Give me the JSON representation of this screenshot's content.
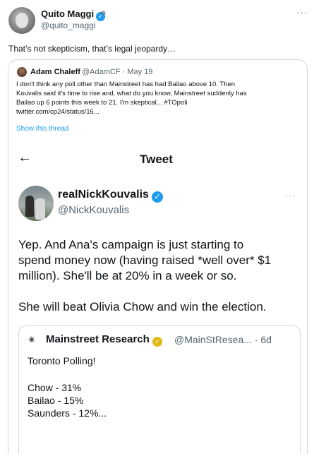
{
  "tweet": {
    "author_name": "Quito Maggi",
    "author_handle": "@quito_maggi",
    "text": "That’s not skepticism, that’s legal jeopardy…"
  },
  "quoted": {
    "author_name": "Adam Chaleff",
    "meta": "@AdamCF · May 19",
    "body_lines": [
      "I don't think any poll other than Mainstreet has had Bailao above 10. Then",
      "Kouvalis said it's time to rise and, what do you know, Mainstreet suddenly has",
      "Bailao up 6 points this week to 21. I'm skeptical... #TOpoli",
      "twitter.com/cp24/status/16..."
    ],
    "show_thread": "Show this thread"
  },
  "embedded": {
    "page_title": "Tweet",
    "author_name": "realNickKouvalis",
    "author_handle": "@NickKouvalis",
    "more": "...",
    "body_lines": [
      "Yep. And Ana's campaign is just starting to",
      "spend money now (having raised *well over* $1",
      "million). She'll be at 20% in a week or so.",
      "She will beat Olivia Chow and win the election."
    ],
    "nested": {
      "author_name": "Mainstreet Research",
      "meta": "@MainStResea... · 6d",
      "body_lines": [
        "Toronto Polling!",
        "Chow - 31%",
        "Bailao - 15%",
        "Saunders - 12%..."
      ]
    }
  },
  "icons": {
    "verified": "✓",
    "extra": "✲",
    "more": "···",
    "back": "←",
    "logo": "✷"
  },
  "colors": {
    "accent": "#1d9bf0",
    "text": "#0f1419",
    "muted": "#536471",
    "border": "#cfd9de",
    "gold_badge": "#e2b719"
  }
}
